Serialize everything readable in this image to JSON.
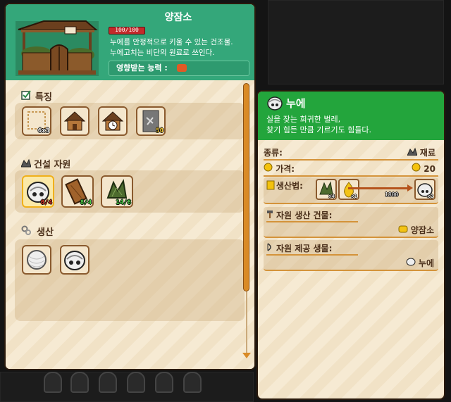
{
  "building": {
    "title": "양잠소",
    "hp": "100/100",
    "hp_fraction": 1.0,
    "description_line1": "누에를 안정적으로 키울 수 있는 건조물.",
    "description_line2": "누에고치는 비단의 원료로 쓰인다.",
    "affected_label": "영향받는 능력 :",
    "affected_icon": "fist-icon"
  },
  "sections": {
    "features": {
      "title": "특징",
      "icon": "checkbox-icon",
      "slots": [
        {
          "icon": "size-frame-icon",
          "badge": "6x3"
        },
        {
          "icon": "house-icon",
          "badge": ""
        },
        {
          "icon": "house-clock-icon",
          "badge": ""
        },
        {
          "icon": "build-cost-icon",
          "badge": "50"
        }
      ]
    },
    "materials": {
      "title": "건설 자원",
      "icon": "material-pile-icon",
      "slots": [
        {
          "icon": "silkworm-icon",
          "badge": "0/4",
          "badge_color": "red"
        },
        {
          "icon": "wood-plank-icon",
          "badge": "8/4",
          "badge_color": "green"
        },
        {
          "icon": "leaf-bundle-icon",
          "badge": "14/8",
          "badge_color": "green"
        }
      ]
    },
    "production": {
      "title": "생산",
      "icon": "gears-icon",
      "slots": [
        {
          "icon": "cocoon-icon"
        },
        {
          "icon": "silkworm-icon"
        }
      ]
    }
  },
  "detail": {
    "title": "누에",
    "icon": "silkworm-icon",
    "desc_line1": "실을 잦는 희귀한 벌레,",
    "desc_line2": "찾기 힘든 만큼 기르기도 힘들다.",
    "type_label": "종류:",
    "type_value": "재료",
    "price_label": "가격:",
    "price_value": "20",
    "recipe_label": "생산법:",
    "recipe": {
      "inputs": [
        {
          "icon": "leaf-bundle-icon",
          "badge": "x4"
        },
        {
          "icon": "oil-drop-icon",
          "badge": "x1"
        }
      ],
      "time": "1800",
      "output": {
        "icon": "silkworm-icon",
        "badge": "x2"
      }
    },
    "building_label": "자원 생산 건물:",
    "building_value": "양잠소",
    "creature_label": "자원 제공 생물:",
    "creature_value": "누에"
  }
}
